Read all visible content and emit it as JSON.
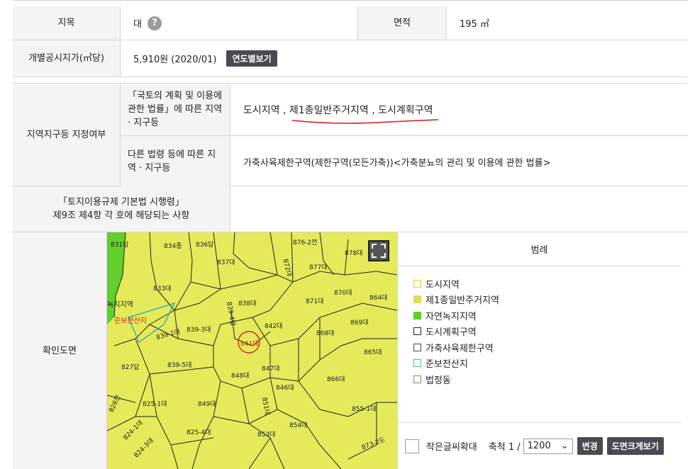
{
  "rows": {
    "jimok": {
      "label": "지목",
      "value": "대",
      "help": "?",
      "area_label": "면적",
      "area_value": "195 ㎡"
    },
    "price": {
      "label": "개별공시지가(㎡당)",
      "value": "5,910원 (2020/01)",
      "button": "연도별보기"
    },
    "zoning": {
      "label": "지역지구등 지정여부",
      "sub1_label": "「국토의 계획 및 이용에 관한 법률」에 따른 지역 · 지구등",
      "sub1_value": "도시지역 , 제1종일반주거지역 , 도시계획구역",
      "sub2_label": "다른 법령 등에 따른 지역 · 지구등",
      "sub2_value": "가축사육제한구역(제한구역(모든가축))<가축분뇨의 관리 및 이용에 관한 법률>"
    },
    "enforcement": {
      "label_line1": "「토지이용규제 기본법 시행령」",
      "label_line2": "제9조 제4항 각 호에 해당되는 사항"
    },
    "map": {
      "label": "확인도면"
    }
  },
  "legend": {
    "title": "범례",
    "items": [
      {
        "label": "도시지역",
        "color": "#e6d000",
        "style": "outline"
      },
      {
        "label": "제1종일반주거지역",
        "color": "#dede5a",
        "style": "fill"
      },
      {
        "label": "자연녹지지역",
        "color": "#5fcf2c",
        "style": "fill"
      },
      {
        "label": "도시계획구역",
        "color": "#222222",
        "style": "outline"
      },
      {
        "label": "가축사육제한구역",
        "color": "#444444",
        "style": "outline"
      },
      {
        "label": "준보전산지",
        "color": "#33c0b0",
        "style": "outline"
      },
      {
        "label": "법정동",
        "color": "#a08060",
        "style": "outline"
      }
    ],
    "small_text_label": "작은글씨확대",
    "scale_label": "축척 1 /",
    "scale_value": "1200",
    "change_button": "변경",
    "view_button": "도면크게보기"
  },
  "map_labels": {
    "parcels": [
      "831답",
      "834종",
      "836답",
      "837대",
      "876-2전",
      "878대",
      "877대",
      "833대",
      "838대",
      "872대",
      "871대",
      "870대",
      "864대",
      "842대",
      "839-4답",
      "839-3대",
      "869대",
      "868대",
      "841대",
      "865대",
      "839-5대",
      "848대",
      "847대",
      "846대",
      "866대",
      "827답",
      "849대",
      "851대",
      "855-1대",
      "826전",
      "825-1대",
      "825-4대",
      "853대",
      "854대",
      "824-1대",
      "824-3대",
      "873-2도",
      "839-1대"
    ],
    "zone_green": "녹지지역",
    "zone_forest": "준보전산지",
    "target_marker": "841대지"
  },
  "colors": {
    "map_yellow": "#e4ea5a",
    "map_green": "#5fcf2c",
    "target_red": "#e0201a",
    "button_dark": "#4a4a52"
  }
}
